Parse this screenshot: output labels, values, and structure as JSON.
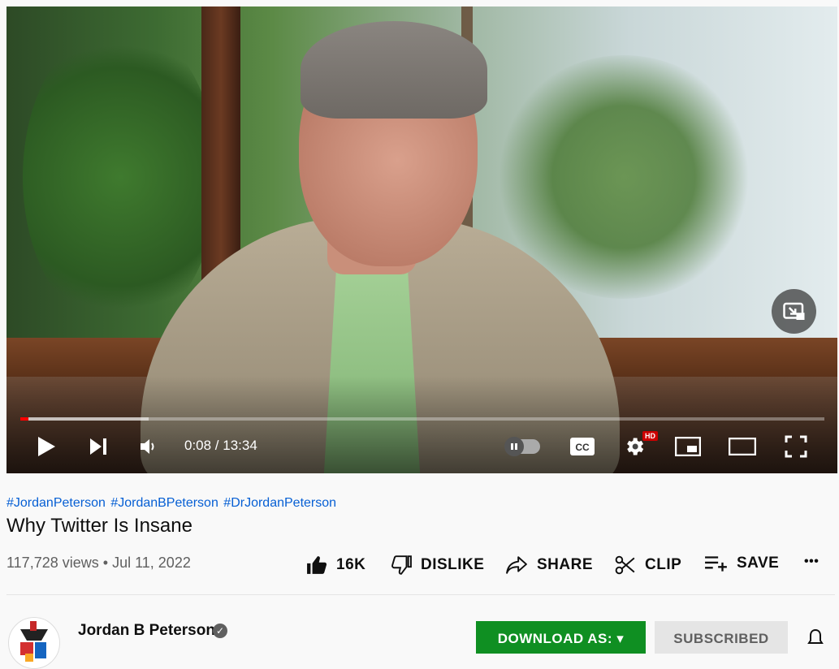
{
  "player": {
    "time_display": "0:08 / 13:34",
    "progress_played_fraction": 0.008,
    "progress_buffered_fraction": 0.16,
    "hd_badge": "HD",
    "cc_label": "CC",
    "icons": [
      "play-icon",
      "next-icon",
      "volume-icon",
      "autoplay-toggle",
      "captions-icon",
      "settings-icon",
      "miniplayer-icon",
      "theater-mode-icon",
      "fullscreen-icon",
      "picture-in-picture-icon"
    ]
  },
  "video": {
    "hashtags": [
      "#JordanPeterson",
      "#JordanBPeterson",
      "#DrJordanPeterson"
    ],
    "title": "Why Twitter Is Insane",
    "views": "117,728 views",
    "separator": "•",
    "date": "Jul 11, 2022"
  },
  "actions": {
    "like_count": "16K",
    "dislike_label": "DISLIKE",
    "share_label": "SHARE",
    "clip_label": "CLIP",
    "save_label": "SAVE",
    "more_label": "•••"
  },
  "channel": {
    "name": "Jordan B Peterson",
    "verified_mark": "✓",
    "download_label": "DOWNLOAD AS: ▾",
    "subscribed_label": "SUBSCRIBED"
  },
  "colors": {
    "hashtag_link": "#065fd4",
    "progress_red": "#ff0000",
    "download_green": "#0f8f22",
    "subscribed_gray": "#e5e5e5"
  }
}
